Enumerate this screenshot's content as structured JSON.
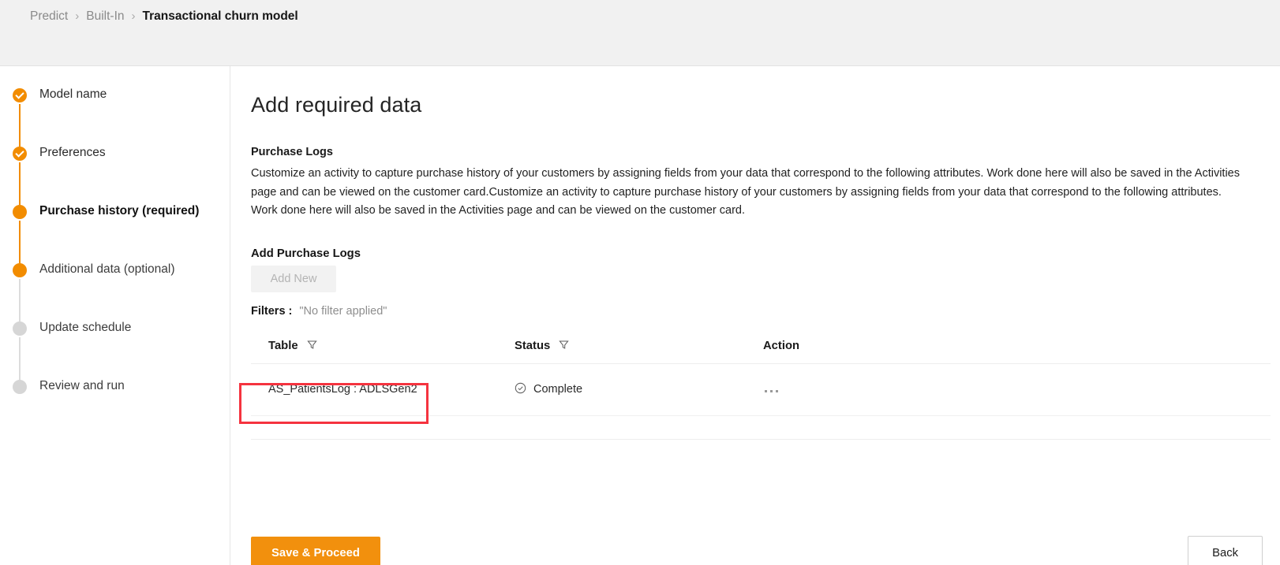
{
  "breadcrumb": {
    "items": [
      {
        "label": "Predict",
        "current": false
      },
      {
        "label": "Built-In",
        "current": false
      },
      {
        "label": "Transactional churn model",
        "current": true
      }
    ],
    "separator": "›"
  },
  "stepper": {
    "steps": [
      {
        "label": "Model name",
        "state": "complete"
      },
      {
        "label": "Preferences",
        "state": "complete"
      },
      {
        "label": "Purchase history (required)",
        "state": "active"
      },
      {
        "label": "Additional data (optional)",
        "state": "active"
      },
      {
        "label": "Update schedule",
        "state": "pending"
      },
      {
        "label": "Review and run",
        "state": "pending"
      }
    ]
  },
  "main": {
    "title": "Add required data",
    "section": {
      "title": "Purchase Logs",
      "description": "Customize an activity to capture purchase history of your customers by assigning fields from your data that correspond to the following attributes. Work done here will also be saved in the Activities page and can be viewed on the customer card.Customize an activity to capture purchase history of your customers by assigning fields from your data that correspond to the following attributes. Work done here will also be saved in the Activities page and can be viewed on the customer card."
    },
    "add_section": {
      "title": "Add Purchase Logs",
      "add_new_label": "Add New"
    },
    "filters": {
      "label": "Filters :",
      "value": "\"No filter applied\""
    },
    "table": {
      "columns": [
        {
          "label": "Table",
          "filter_icon": "funnel-icon"
        },
        {
          "label": "Status",
          "filter_icon": "funnel-icon"
        },
        {
          "label": "Action",
          "filter_icon": null
        }
      ],
      "rows": [
        {
          "table": "AS_PatientsLog : ADLSGen2",
          "status": "Complete",
          "status_icon": "check-circle-icon",
          "action_icon": "ellipsis-icon"
        }
      ]
    }
  },
  "footer": {
    "save_label": "Save & Proceed",
    "back_label": "Back"
  },
  "colors": {
    "accent": "#f2900d",
    "step_complete": "#f28c00",
    "step_pending": "#d6d6d6",
    "highlight": "#f5333f",
    "topbar_bg": "#f1f1f1"
  }
}
